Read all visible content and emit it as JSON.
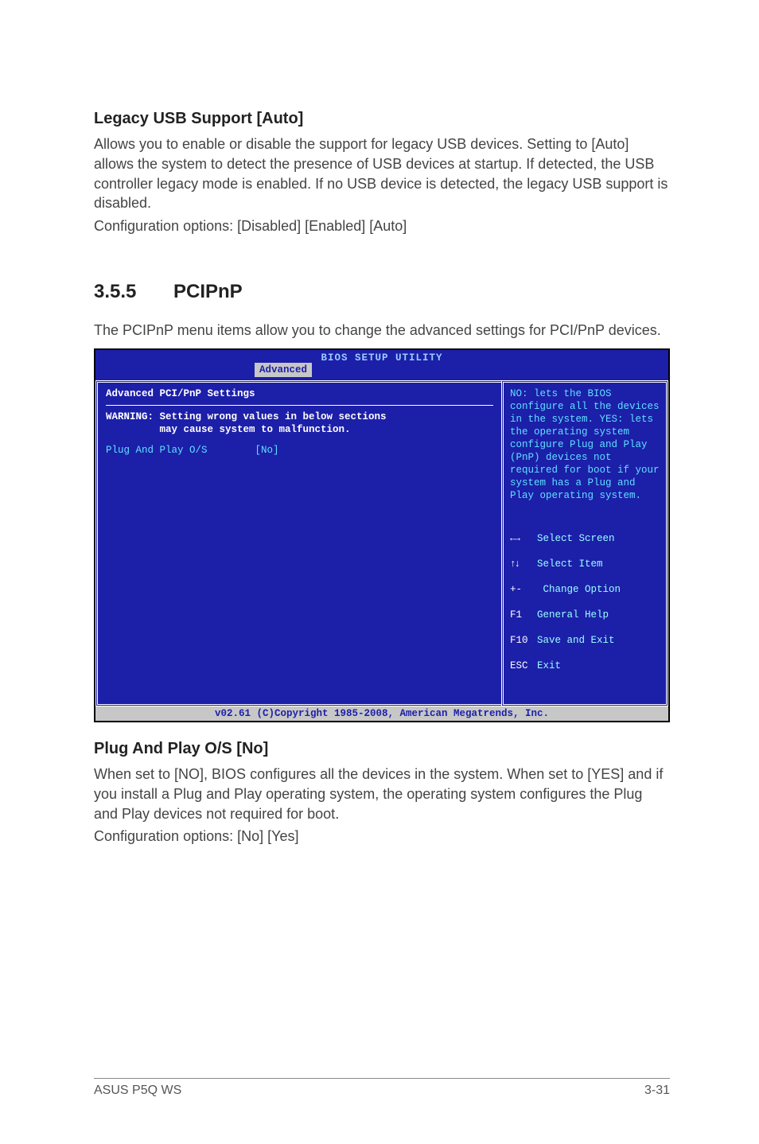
{
  "section1": {
    "heading": "Legacy USB Support [Auto]",
    "para1": "Allows you to enable or disable the support for legacy USB devices. Setting to [Auto] allows the system to detect the presence of USB devices at startup. If detected, the USB controller legacy mode is enabled. If no USB device is detected, the legacy USB support is disabled.",
    "para2": "Configuration options: [Disabled] [Enabled] [Auto]"
  },
  "section2": {
    "num": "3.5.5",
    "title": "PCIPnP",
    "intro": "The PCIPnP menu items allow you to change the advanced settings for PCI/PnP devices."
  },
  "bios": {
    "title": "BIOS SETUP UTILITY",
    "tab": "Advanced",
    "panel_title": "Advanced PCI/PnP Settings",
    "warning": "WARNING: Setting wrong values in below sections\n         may cause system to malfunction.",
    "field_label": "Plug And Play O/S",
    "field_value": "[No]",
    "help": "NO: lets the BIOS configure all the devices in the system.\nYES: lets the operating system configure Plug and Play (PnP) devices not required for boot if your system has a Plug and Play operating system.",
    "keys": {
      "select_screen": "Select Screen",
      "select_item": "Select Item",
      "change_option": "Change Option",
      "general_help": "General Help",
      "save_exit": "Save and Exit",
      "exit": "Exit",
      "k_plusminus": "+-",
      "k_f1": "F1",
      "k_f10": "F10",
      "k_esc": "ESC"
    },
    "footer": "v02.61 (C)Copyright 1985-2008, American Megatrends, Inc."
  },
  "section3": {
    "heading": "Plug And Play O/S [No]",
    "para1": "When set to [NO], BIOS configures all the devices in the system. When set to [YES] and if you install a Plug and Play operating system, the operating system configures the Plug and Play devices not required for boot.",
    "para2": "Configuration options: [No] [Yes]"
  },
  "footer": {
    "left": "ASUS P5Q WS",
    "right": "3-31"
  }
}
